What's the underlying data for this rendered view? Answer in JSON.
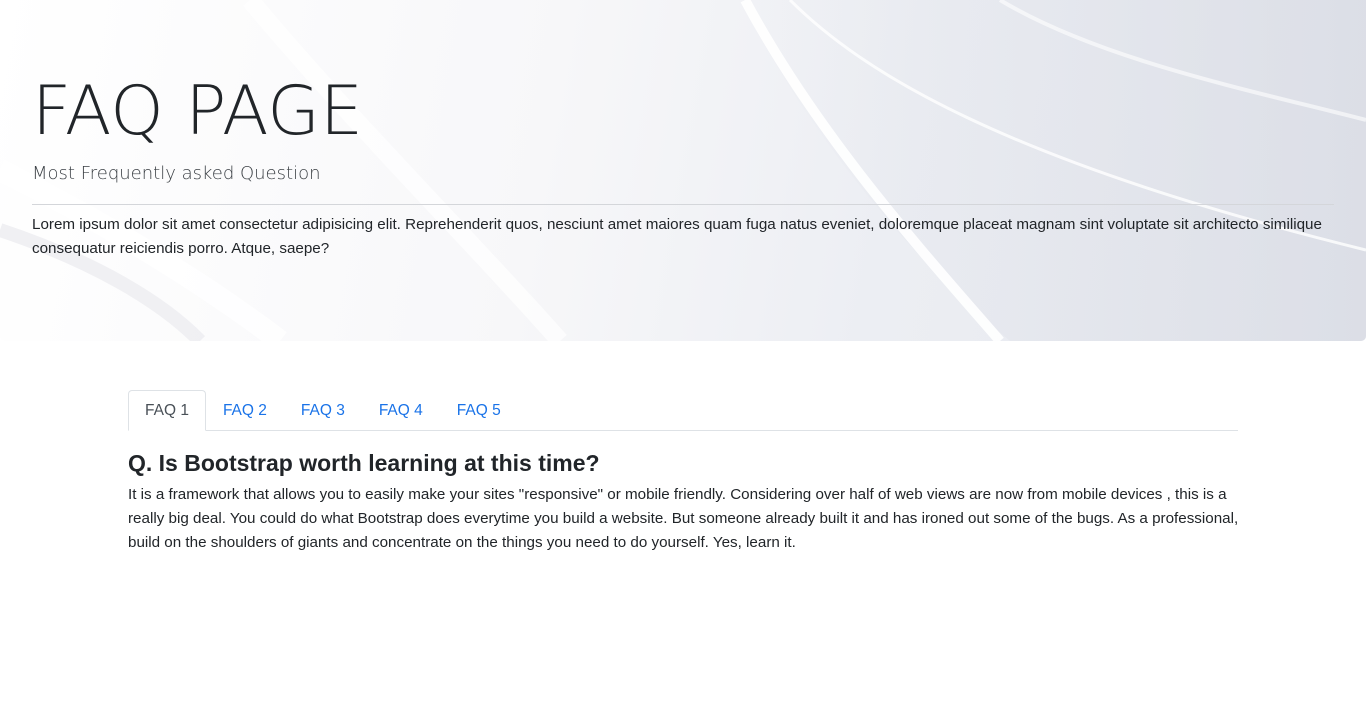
{
  "hero": {
    "title": "FAQ PAGE",
    "subtitle": "Most Frequently asked Question",
    "description": "Lorem ipsum dolor sit amet consectetur adipisicing elit. Reprehenderit quos, nesciunt amet maiores quam fuga natus eveniet, doloremque placeat magnam sint voluptate sit architecto similique consequatur reiciendis porro. Atque, saepe?"
  },
  "tabs": [
    {
      "label": "FAQ 1",
      "active": true
    },
    {
      "label": "FAQ 2",
      "active": false
    },
    {
      "label": "FAQ 3",
      "active": false
    },
    {
      "label": "FAQ 4",
      "active": false
    },
    {
      "label": "FAQ 5",
      "active": false
    }
  ],
  "faq": {
    "question": "Q. Is Bootstrap worth learning at this time?",
    "answer": "It is a framework that allows you to easily make your sites \"responsive\" or mobile friendly. Considering over half of web views are now from mobile devices , this is a really big deal. You could do what Bootstrap does everytime you build a website. But someone already built it and has ironed out some of the bugs. As a professional, build on the shoulders of giants and concentrate on the things you need to do yourself. Yes, learn it."
  },
  "colors": {
    "tab_link": "#1a73e8",
    "tab_active": "#495057",
    "text": "#212529",
    "border": "#dee2e6"
  }
}
